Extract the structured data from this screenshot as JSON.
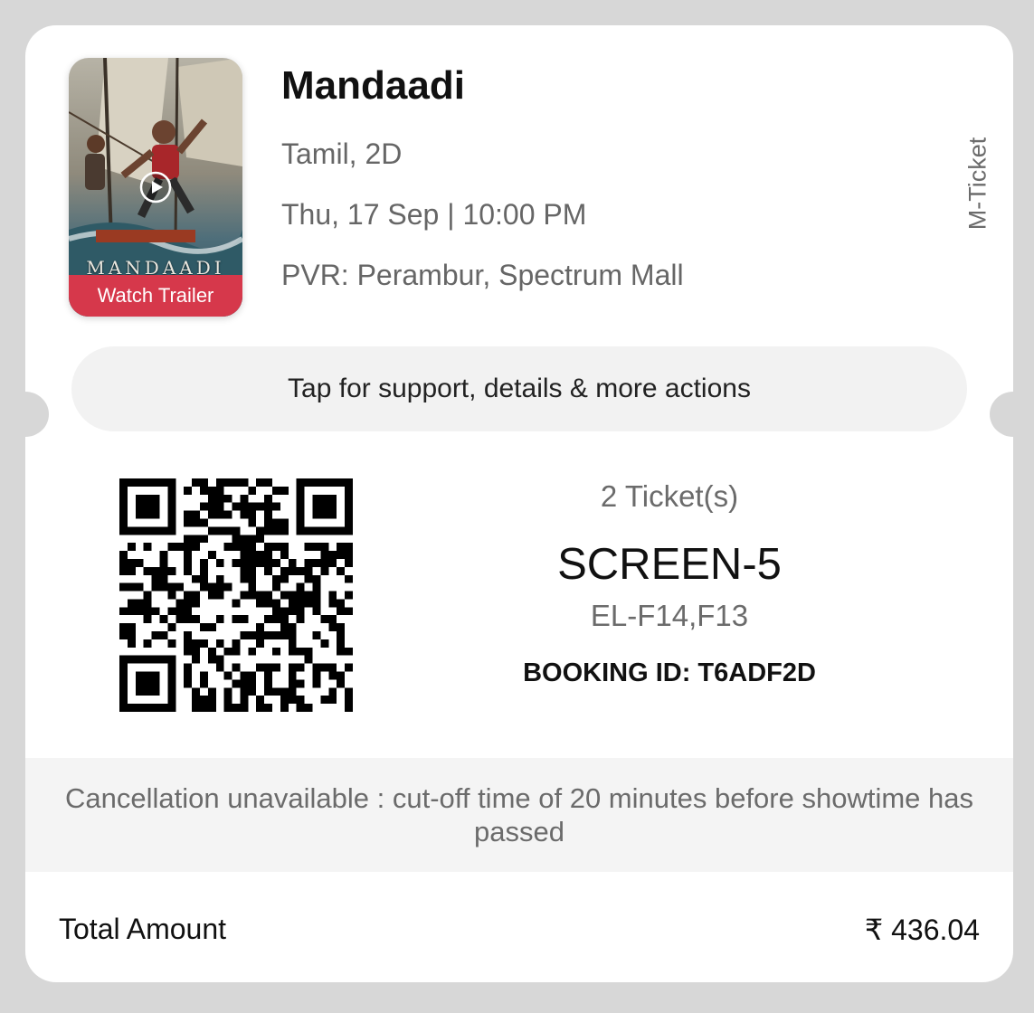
{
  "movie": {
    "poster_title": "MANDAADI",
    "trailer_label": "Watch Trailer",
    "title": "Mandaadi",
    "language_format": "Tamil, 2D",
    "datetime": "Thu, 17 Sep | 10:00 PM",
    "venue": "PVR: Perambur, Spectrum Mall"
  },
  "ticket_type": "M-Ticket",
  "support_label": "Tap for support, details & more actions",
  "booking": {
    "tickets_count": "2 Ticket(s)",
    "screen": "SCREEN-5",
    "seats": "EL-F14,F13",
    "booking_id": "BOOKING ID: T6ADF2D"
  },
  "cancellation_note": "Cancellation unavailable : cut-off time of 20 minutes before showtime has passed",
  "total": {
    "label": "Total Amount",
    "value": "₹ 436.04"
  },
  "colors": {
    "accent": "#d6384b",
    "background": "#d7d7d7",
    "card": "#ffffff"
  }
}
